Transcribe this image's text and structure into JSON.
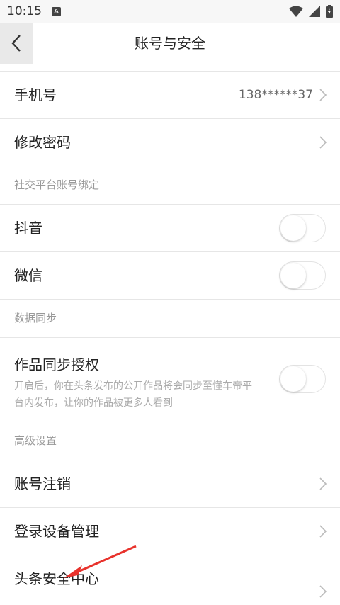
{
  "status": {
    "time": "10:15",
    "notice": "A"
  },
  "nav": {
    "title": "账号与安全"
  },
  "rows": {
    "phone": {
      "label": "手机号",
      "value": "138******37"
    },
    "password": {
      "label": "修改密码"
    }
  },
  "sections": {
    "social": "社交平台账号绑定",
    "sync": "数据同步",
    "advanced": "高级设置"
  },
  "social": {
    "douyin": {
      "label": "抖音",
      "enabled": false
    },
    "wechat": {
      "label": "微信",
      "enabled": false
    }
  },
  "sync": {
    "label": "作品同步授权",
    "desc": "开启后，你在头条发布的公开作品将会同步至懂车帝平台内发布，让你的作品被更多人看到",
    "enabled": false
  },
  "advanced": {
    "cancel": {
      "label": "账号注销"
    },
    "devices": {
      "label": "登录设备管理"
    },
    "security": {
      "label": "头条安全中心"
    }
  },
  "colors": {
    "annotation_arrow": "#e8322c",
    "divider": "#e6e6e6"
  }
}
